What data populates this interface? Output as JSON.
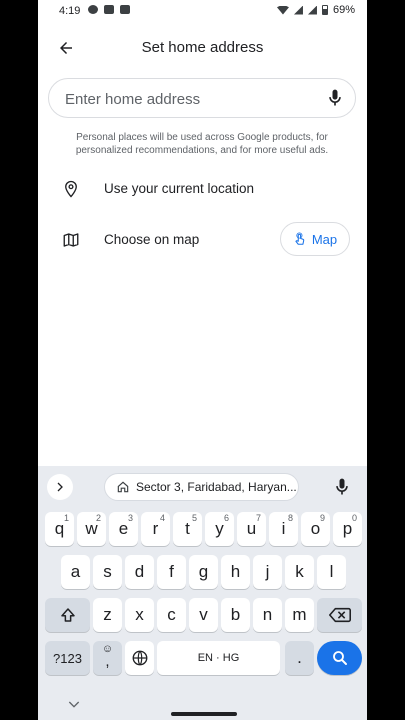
{
  "status_bar": {
    "time": "4:19",
    "battery": "69%"
  },
  "header": {
    "title": "Set home address"
  },
  "address_field": {
    "placeholder": "Enter home address",
    "value": ""
  },
  "disclaimer": "Personal places will be used across Google products, for personalized recommendations, and for more useful ads.",
  "options": {
    "current_location": "Use your current location",
    "choose_on_map": "Choose on map",
    "map_button": "Map"
  },
  "keyboard": {
    "suggestion": "Sector 3, Faridabad, Haryan...",
    "row1": [
      {
        "key": "q",
        "num": "1"
      },
      {
        "key": "w",
        "num": "2"
      },
      {
        "key": "e",
        "num": "3"
      },
      {
        "key": "r",
        "num": "4"
      },
      {
        "key": "t",
        "num": "5"
      },
      {
        "key": "y",
        "num": "6"
      },
      {
        "key": "u",
        "num": "7"
      },
      {
        "key": "i",
        "num": "8"
      },
      {
        "key": "o",
        "num": "9"
      },
      {
        "key": "p",
        "num": "0"
      }
    ],
    "row2": [
      "a",
      "s",
      "d",
      "f",
      "g",
      "h",
      "j",
      "k",
      "l"
    ],
    "row3": [
      "z",
      "x",
      "c",
      "v",
      "b",
      "n",
      "m"
    ],
    "symbols_label": "?123",
    "emoji_label": ",",
    "space_label": "EN · HG",
    "period_label": "."
  },
  "colors": {
    "accent": "#1a73e8",
    "keyboard_bg": "#e8ebf0"
  },
  "icons": [
    "back-arrow-icon",
    "mic-icon",
    "location-pin-icon",
    "map-icon",
    "touch-icon",
    "chevron-right-icon",
    "home-icon",
    "shift-icon",
    "backspace-icon",
    "globe-icon",
    "search-icon",
    "chevron-down-icon"
  ]
}
